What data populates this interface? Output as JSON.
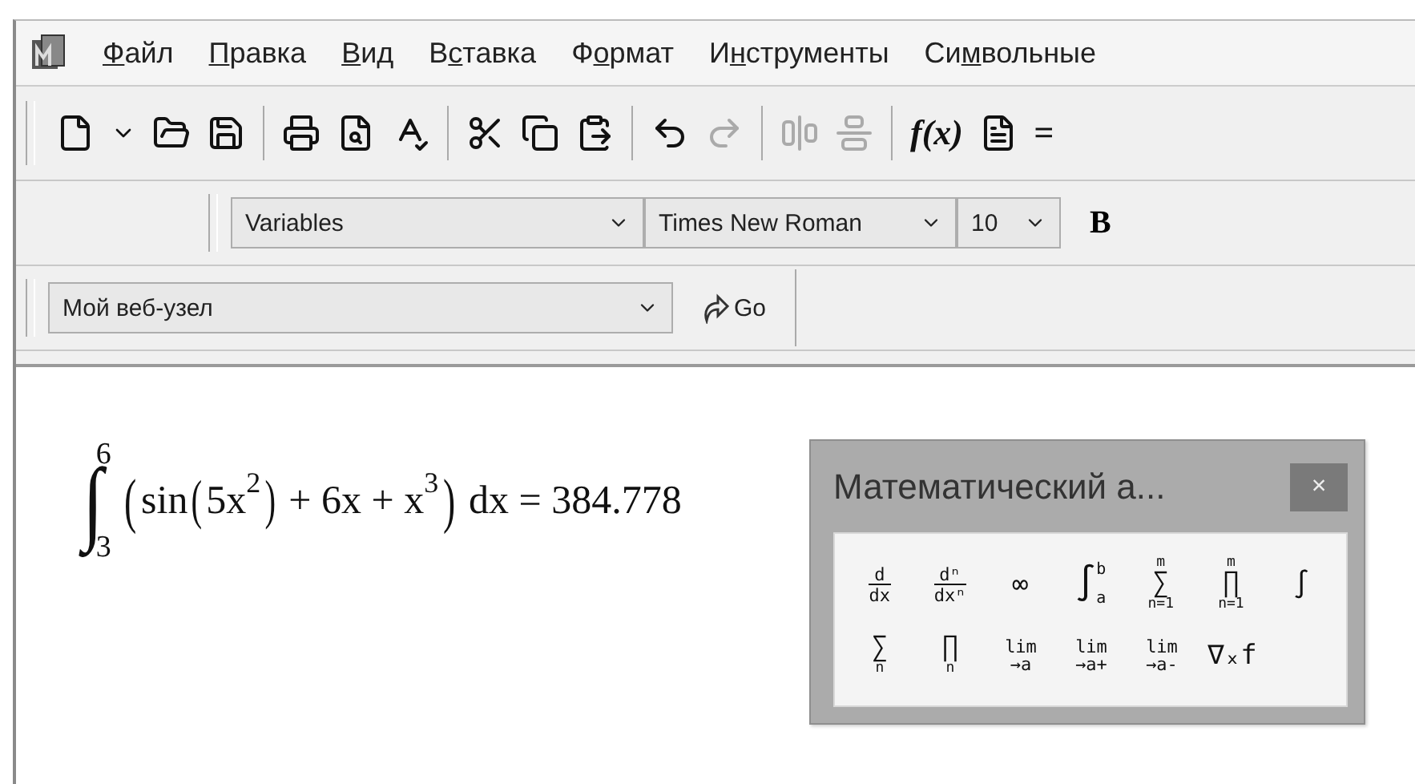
{
  "menu": [
    {
      "key": "Ф",
      "after": "айл"
    },
    {
      "key": "П",
      "after": "равка"
    },
    {
      "key": "В",
      "after": "ид"
    },
    {
      "before": "В",
      "key": "с",
      "after": "тавка"
    },
    {
      "before": "Ф",
      "key": "о",
      "after": "рмат"
    },
    {
      "before": "И",
      "key": "н",
      "after": "струменты"
    },
    {
      "before": "Си",
      "key": "м",
      "after": "вольные"
    }
  ],
  "toolbar": [
    {
      "kind": "icon",
      "disabled": false
    },
    {
      "kind": "icon",
      "disabled": false
    },
    {
      "kind": "icon",
      "disabled": false
    },
    {
      "kind": "icon",
      "disabled": false
    },
    {
      "kind": "separator"
    },
    {
      "kind": "icon",
      "disabled": false
    },
    {
      "kind": "icon",
      "disabled": false
    },
    {
      "kind": "icon",
      "disabled": false
    },
    {
      "kind": "separator"
    },
    {
      "kind": "icon",
      "disabled": false
    },
    {
      "kind": "icon",
      "disabled": false
    },
    {
      "kind": "icon",
      "disabled": false
    },
    {
      "kind": "separator"
    },
    {
      "kind": "icon",
      "disabled": false
    },
    {
      "kind": "icon",
      "disabled": true
    },
    {
      "kind": "separator"
    },
    {
      "kind": "icon",
      "disabled": true
    },
    {
      "kind": "icon",
      "disabled": true
    },
    {
      "kind": "separator"
    },
    {
      "kind": "text",
      "text": "f(x)",
      "disabled": false
    },
    {
      "kind": "icon",
      "disabled": false
    },
    {
      "kind": "text",
      "text": "=",
      "disabled": false
    }
  ],
  "format_bar": {
    "style": "Variables",
    "font": "Times New Roman",
    "size": "10",
    "bold": "B"
  },
  "web_bar": {
    "address": "Мой веб-узел",
    "go": "Go"
  },
  "formula": {
    "integral": "∫",
    "upper": "6",
    "lower": "3",
    "open": "(",
    "sin": "sin",
    "inner_open": "(",
    "base": "5x",
    "exp": "2",
    "inner_close": ")",
    "middle": "+ 6x + x",
    "exp2": "3",
    "close": ")",
    "tail": "dx =",
    "result": "384.778"
  },
  "palette": {
    "title": "Математический а...",
    "close": "×",
    "rows": [
      [
        {
          "kind": "fraction",
          "top": "d",
          "bottom": "dx"
        },
        {
          "kind": "fraction",
          "top": "dⁿ",
          "bottom": "dxⁿ"
        },
        {
          "kind": "char",
          "text": "∞"
        },
        {
          "kind": "integral",
          "symbol": "∫",
          "top": "b",
          "bottom": "a"
        },
        {
          "kind": "operator",
          "symbol": "∑",
          "top": "m",
          "bottom": "n=1"
        },
        {
          "kind": "operator",
          "symbol": "∏",
          "top": "m",
          "bottom": "n=1"
        },
        {
          "kind": "char",
          "text": "∫"
        }
      ],
      [
        {
          "kind": "operator",
          "symbol": "∑",
          "bottom": "n"
        },
        {
          "kind": "operator",
          "symbol": "∏",
          "bottom": "n"
        },
        {
          "kind": "limit",
          "top": "lim",
          "bottom": "→a"
        },
        {
          "kind": "limit",
          "top": "lim",
          "bottom": "→a+"
        },
        {
          "kind": "limit",
          "top": "lim",
          "bottom": "→a-"
        },
        {
          "kind": "char",
          "text": "∇ₓf"
        }
      ]
    ]
  }
}
